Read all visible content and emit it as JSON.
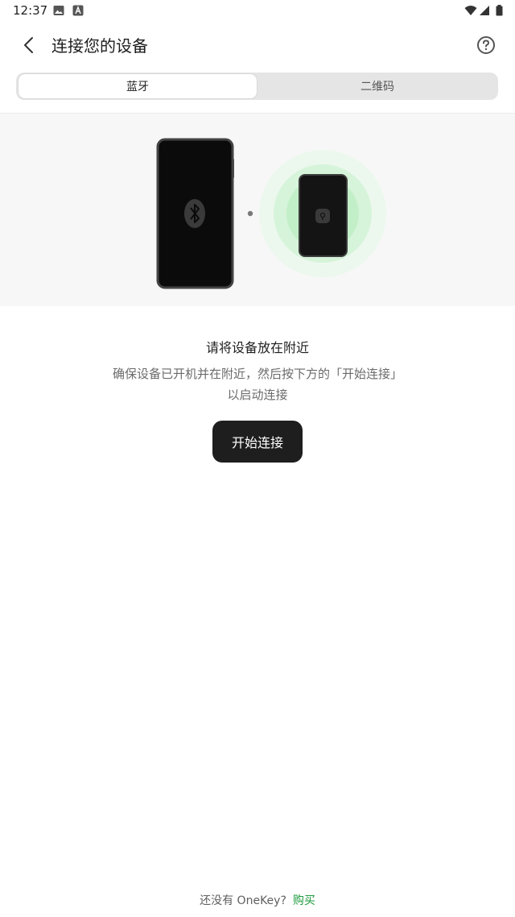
{
  "status_bar": {
    "time": "12:37",
    "icons": [
      "image-icon",
      "a-notification-icon",
      "wifi-icon",
      "signal-icon",
      "battery-icon"
    ]
  },
  "app_bar": {
    "title": "连接您的设备",
    "back_icon": "chevron-left-icon",
    "help_icon": "question-circle-icon"
  },
  "tabs": [
    {
      "label": "蓝牙",
      "selected": true
    },
    {
      "label": "二维码",
      "selected": false
    }
  ],
  "illustration": {
    "phone_icon": "bluetooth-icon",
    "device_icon": "onekey-lock-icon",
    "accent_color": "#c9f3cf"
  },
  "content": {
    "heading": "请将设备放在附近",
    "description": "确保设备已开机并在附近，然后按下方的「开始连接」以启动连接",
    "start_button": "开始连接"
  },
  "footer": {
    "text": "还没有 OneKey?",
    "link": "购买",
    "link_color": "#1b9a3b"
  }
}
